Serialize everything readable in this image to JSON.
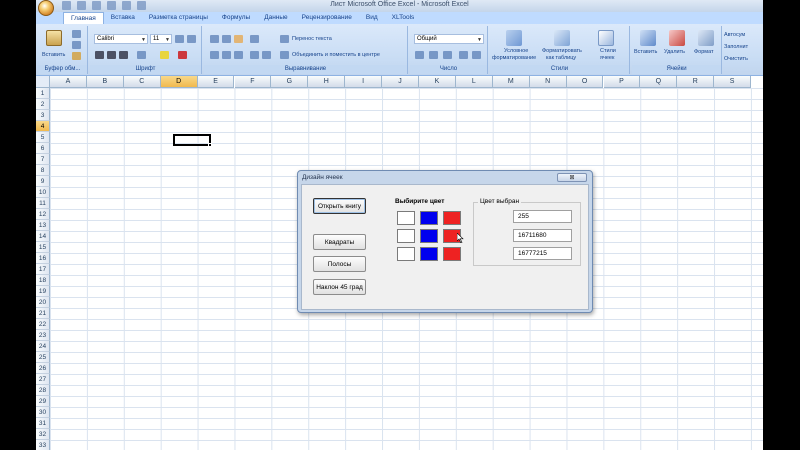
{
  "window": {
    "title": "Лист Microsoft Office Excel - Microsoft Excel"
  },
  "tabs": [
    {
      "label": "Главная",
      "active": true
    },
    {
      "label": "Вставка"
    },
    {
      "label": "Разметка страницы"
    },
    {
      "label": "Формулы"
    },
    {
      "label": "Данные"
    },
    {
      "label": "Рецензирование"
    },
    {
      "label": "Вид"
    },
    {
      "label": "XLTools"
    }
  ],
  "ribbon": {
    "paste_label": "Вставить",
    "clipboard_label": "Буфер обм...",
    "font_name": "Calibri",
    "font_size": "11",
    "font_label": "Шрифт",
    "wrap_text": "Перенос текста",
    "merge_center": "Объединить и поместить в центре",
    "alignment_label": "Выравнивание",
    "number_format": "Общий",
    "number_label": "Число",
    "cond_format_1": "Условное",
    "cond_format_2": "форматирование",
    "format_table_1": "Форматировать",
    "format_table_2": "как таблицу",
    "cell_styles_1": "Стили",
    "cell_styles_2": "ячеек",
    "styles_label": "Стили",
    "insert_label": "Вставить",
    "delete_label": "Удалить",
    "format_label": "Формат",
    "cells_label": "Ячейки",
    "autosum": "Автосум",
    "fill": "Заполнит",
    "clear": "Очистить"
  },
  "grid": {
    "columns": [
      "A",
      "B",
      "C",
      "D",
      "E",
      "F",
      "G",
      "H",
      "I",
      "J",
      "K",
      "L",
      "M",
      "N",
      "O",
      "P",
      "Q",
      "R",
      "S"
    ],
    "selected_column": "D",
    "rows": [
      "1",
      "2",
      "3",
      "4",
      "5",
      "6",
      "7",
      "8",
      "9",
      "10",
      "11",
      "12",
      "13",
      "14",
      "15",
      "16",
      "17",
      "18",
      "19",
      "20",
      "21",
      "22",
      "23",
      "24",
      "25",
      "26",
      "27",
      "28",
      "29",
      "30",
      "31",
      "32",
      "33"
    ],
    "selected_row": "4"
  },
  "dialog": {
    "title": "Дизайн ячеек",
    "close_symbol": "⊠",
    "open_book": "Открыть книгу",
    "squares": "Квадраты",
    "stripes": "Полосы",
    "tilt": "Наклон 45 град",
    "choose_color": "Выбирите цвет",
    "color_chosen": "Цвет выбран",
    "swatch_colors": {
      "white": "#ffffff",
      "blue": "#0000ee",
      "red": "#ee2222"
    },
    "values": [
      "255",
      "16711680",
      "16777215"
    ]
  }
}
